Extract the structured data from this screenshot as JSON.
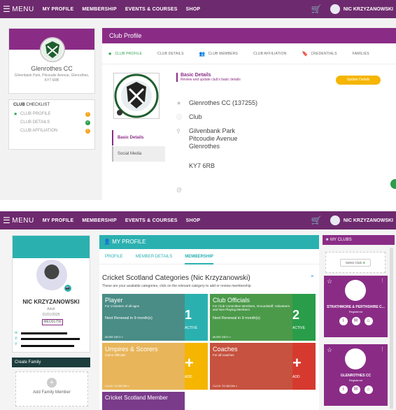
{
  "topbar1": {
    "menu": "MENU",
    "nav": [
      "MY PROFILE",
      "MEMBERSHIP",
      "EVENTS & COURSES",
      "SHOP"
    ],
    "user": "NIC KRZYZANOWSKI"
  },
  "club": {
    "name": "Glenrothes CC",
    "address": "Gilvenbank Park, Pitcoudie Avenue, Glenrothes, KY7 6RB",
    "checklist_title_bold": "CLUB",
    "checklist_title_rest": " CHECKLIST",
    "checklist": [
      {
        "label": "CLUB PROFILE",
        "status": "!"
      },
      {
        "label": "CLUB DETAILS",
        "status": "✓"
      },
      {
        "label": "CLUB AFFILIATION",
        "status": "!"
      }
    ],
    "header": "Club Profile",
    "tabs": [
      "CLUB PROFILE",
      "CLUB DETAILS",
      "CLUB MEMBERS",
      "CLUB AFFILIATION",
      "CREDENTIALS",
      "FAMILIES"
    ],
    "sidenav": [
      "Basic Details",
      "Social Media"
    ],
    "basic_title": "Basic Details",
    "basic_sub": "Review and update club's basic details",
    "update_label": "Update Details",
    "detail_name": "Glenrothes CC (137255)",
    "detail_type": "Club",
    "detail_addr1": "Gilvenbank Park",
    "detail_addr2": "Pitcoudie Avenue",
    "detail_addr3": "Glenrothes",
    "detail_postcode": "KY7 6RB"
  },
  "topbar2": {
    "menu": "MENU",
    "nav": [
      "MY PROFILE",
      "MEMBERSHIP",
      "EVENTS & COURSES",
      "SHOP"
    ],
    "user": "NIC KRZYZANOWSKI"
  },
  "profile": {
    "name": "NIC KRZYZANOWSKI",
    "type": "Adult",
    "dob": "01/01/2025",
    "member_id": "MEO01756",
    "create_family": "Create Family",
    "add_family": "Add Family Member",
    "header": "MY PROFILE",
    "tabs": [
      "PROFILE",
      "MEMBER DETAILS",
      "MEMBERSHIP"
    ],
    "cat_title": "Cricket Scotland Categories (Nic Krzyzanowski)",
    "cat_sub": "These are your available categories, click on the relevant category to add or review membership"
  },
  "tiles": [
    {
      "name": "Player",
      "desc": "For cricketers of all ages",
      "renew": "Next Renewal in 9 month(s)",
      "more": "MORE INFO »",
      "count": "1",
      "state": "ACTIVE"
    },
    {
      "name": "Club Officials",
      "desc": "For Club Committee Members, Groundstaff, Volunteers and Non Playing Members",
      "renew": "Next Renewal in 9 month(s)",
      "more": "MORE INFO »",
      "count": "2",
      "state": "ACTIVE"
    },
    {
      "name": "Umpires & Scorers",
      "desc": "Game Officials",
      "more": "CLICK TO BEGIN »",
      "plus": "+",
      "state": "ADD"
    },
    {
      "name": "Coaches",
      "desc": "For all coaches",
      "more": "CLICK TO BEGIN »",
      "plus": "+",
      "state": "ADD"
    },
    {
      "name": "Cricket Scotland Member"
    }
  ],
  "myclubs": {
    "header": "MY CLUBS",
    "select_label": "Select Club",
    "clubs": [
      {
        "name": "STRATHMORE & PERTHSHIRE C...",
        "status": "Registered"
      },
      {
        "name": "GLENROTHES CC",
        "status": "Registered"
      }
    ]
  },
  "colors": {
    "purple": "#8a2c86",
    "teal": "#2bb0b0",
    "green": "#2a9d4a",
    "amber": "#f5b500"
  }
}
